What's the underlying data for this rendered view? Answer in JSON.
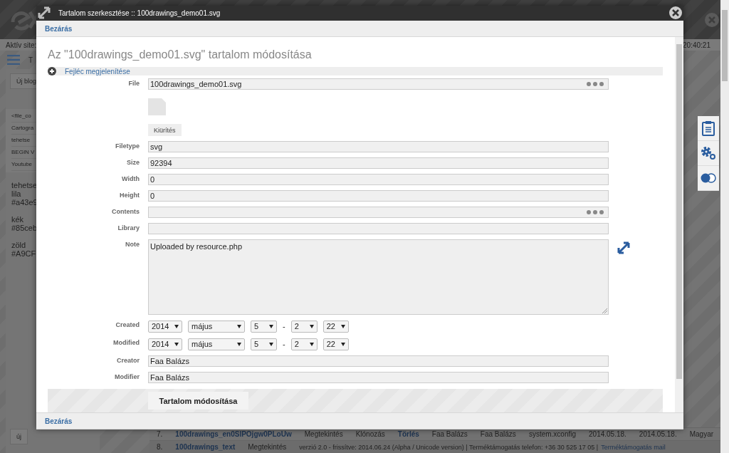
{
  "background_page": {
    "active_site_label": "Aktív site:",
    "clock": "20:40:21",
    "menu_letter": "T",
    "new_blog_button": "Új blog",
    "list_items": [
      "<file_co",
      "Cartogra",
      "tehetse",
      "BEGIN V",
      "Youtube"
    ],
    "notes": [
      [
        "tehetse",
        "lila",
        "#a43e9"
      ],
      [
        "kék",
        "#85ceb"
      ],
      [
        "zöld",
        "#A9CF"
      ]
    ],
    "new_button": "új",
    "table_rows": [
      {
        "number": "7.",
        "name": "100drawings_en0SIPOjgw0PLoUw",
        "view": "Megtekintés",
        "clone": "Klónozás",
        "delete": "Törlés",
        "creator": "Faa Balázs",
        "modifier": "Faa Balázs",
        "library": "system.xconfig",
        "created": "2014.05.18.",
        "modified": "2014.05.18.",
        "language": "Magyar"
      },
      {
        "number": "8.",
        "name": "100drawings_text",
        "view": "Megtekintés"
      }
    ],
    "footer": {
      "text": "verzió 2.0 - frissítve: 2014.06.24 (Alpha / Unicode version) | Terméktámogatás telefon: +36 30 525 17 05 |",
      "link": "Terméktámogatás mail"
    }
  },
  "dialog": {
    "title": "Tartalom szerkesztése :: 100drawings_demo01.svg",
    "top_close": "Bezárás",
    "heading": "Az \"100drawings_demo01.svg\" tartalom módosítása",
    "header_toggle": "Fejléc megjelenítése",
    "fields": [
      {
        "label": "File",
        "kind": "file",
        "value": "100drawings_demo01.svg",
        "clear_button": "Kiürítés"
      },
      {
        "label": "Filetype",
        "kind": "text",
        "value": "svg"
      },
      {
        "label": "Size",
        "kind": "text",
        "value": "92394"
      },
      {
        "label": "Width",
        "kind": "text",
        "value": "0"
      },
      {
        "label": "Height",
        "kind": "text",
        "value": "0"
      },
      {
        "label": "Contents",
        "kind": "picker"
      },
      {
        "label": "Library",
        "kind": "text"
      },
      {
        "label": "Note",
        "kind": "textarea",
        "value": "Uploaded by resource.php"
      },
      {
        "label": "Created",
        "kind": "date",
        "year": "2014",
        "month": "május",
        "day": "5",
        "separator": "-",
        "hour": "2",
        "minute": "22"
      },
      {
        "label": "Modified",
        "kind": "date",
        "year": "2014",
        "month": "május",
        "day": "5",
        "separator": "-",
        "hour": "2",
        "minute": "22"
      },
      {
        "label": "Creator",
        "kind": "text",
        "value": "Faa Balázs"
      },
      {
        "label": "Modifier",
        "kind": "text",
        "value": "Faa Balázs"
      }
    ],
    "submit": "Tartalom módosítása",
    "bottom_close": "Bezárás"
  }
}
